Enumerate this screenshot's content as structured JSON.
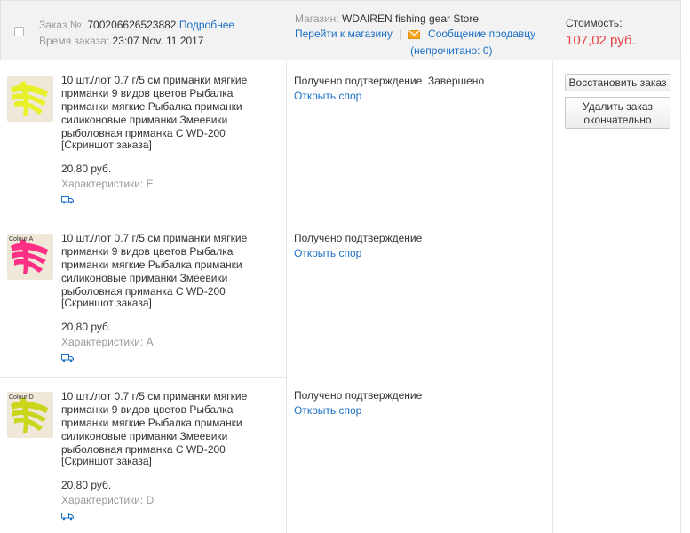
{
  "header": {
    "order_label": "Заказ №:",
    "order_number": "700206626523882",
    "details_link": "Подробнее",
    "time_label": "Время заказа:",
    "time_value": "23:07 Nov. 11 2017",
    "store_label": "Магазин:",
    "store_name": "WDAIREN fishing gear Store",
    "go_to_store": "Перейти к магазину",
    "separator": "|",
    "message_seller": "Сообщение продавцу",
    "unread": "(непрочитано: 0)",
    "cost_label": "Стоимость:",
    "cost_value": "107,02 руб."
  },
  "order_status": "Завершено",
  "actions": {
    "restore": "Восстановить заказ",
    "delete_line1": "Удалить заказ",
    "delete_line2": "окончательно"
  },
  "items": [
    {
      "title": "10 шт./лот 0.7 г/5 см приманки мягкие приманки 9 видов цветов Рыбалка приманки мягкие Рыбалка приманки силиконовые приманки Змеевики рыболовная приманка С WD-200",
      "screenshot": "[Скриншот заказа]",
      "price": "20,80 руб.",
      "attrs": "Характеристики: E",
      "status": "Получено подтверждение",
      "dispute": "Открыть спор",
      "thumb_color": "#e8f02a",
      "thumb_label": ""
    },
    {
      "title": "10 шт./лот 0.7 г/5 см приманки мягкие приманки 9 видов цветов Рыбалка приманки мягкие Рыбалка приманки силиконовые приманки Змеевики рыболовная приманка С WD-200",
      "screenshot": "[Скриншот заказа]",
      "price": "20,80 руб.",
      "attrs": "Характеристики: A",
      "status": "Получено подтверждение",
      "dispute": "Открыть спор",
      "thumb_color": "#ff2f86",
      "thumb_label": "Colour:A"
    },
    {
      "title": "10 шт./лот 0.7 г/5 см приманки мягкие приманки 9 видов цветов Рыбалка приманки мягкие Рыбалка приманки силиконовые приманки Змеевики рыболовная приманка С WD-200",
      "screenshot": "[Скриншот заказа]",
      "price": "20,80 руб.",
      "attrs": "Характеристики: D",
      "status": "Получено подтверждение",
      "dispute": "Открыть спор",
      "thumb_color": "#c9d61c",
      "thumb_label": "Colour:D"
    }
  ]
}
